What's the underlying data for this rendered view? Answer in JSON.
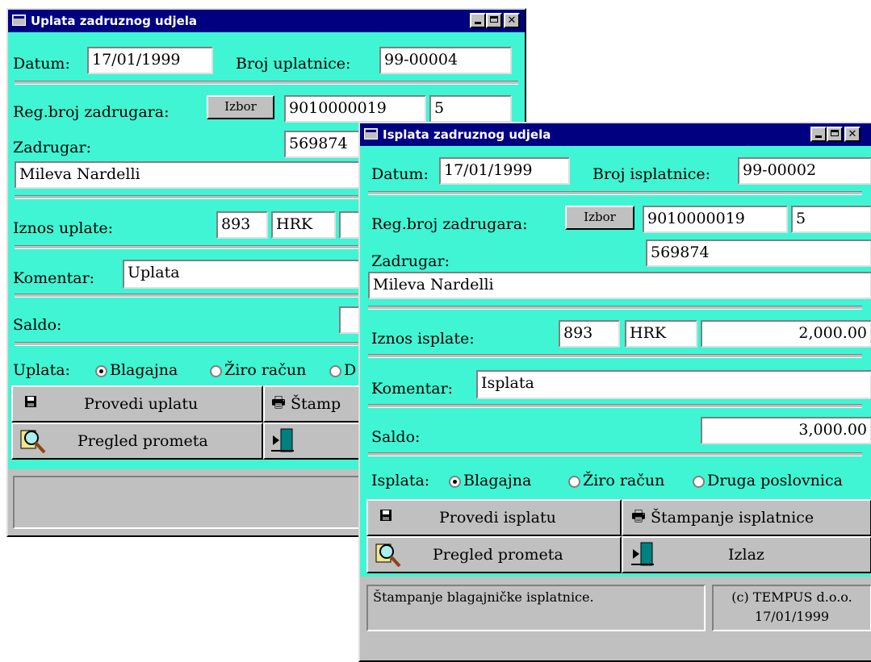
{
  "uplata": {
    "title": "Uplata zadruznog udjela",
    "datum_label": "Datum:",
    "datum_value": "17/01/1999",
    "broj_label": "Broj uplatnice:",
    "broj_value": "99-00004",
    "reg_label": "Reg.broj zadrugara:",
    "izbor": "Izbor",
    "reg_value": "9010000019",
    "reg_extra": "5",
    "zadrugar_label": "Zadrugar:",
    "zadrugar_value": "569874",
    "zadrugar_name": "Mileva Nardelli",
    "iznos_label": "Iznos uplate:",
    "iznos_value": "893",
    "currency": "HRK",
    "komentar_label": "Komentar:",
    "komentar_value": "Uplata",
    "saldo_label": "Saldo:",
    "nacin_label": "Uplata:",
    "opt_blagajna": "Blagajna",
    "opt_ziro": "Žiro račun",
    "opt_druga": "D",
    "btn_provedi": "Provedi uplatu",
    "btn_stampanje": "Štamp",
    "btn_pregled": "Pregled prometa"
  },
  "isplata": {
    "title": "Isplata zadruznog udjela",
    "datum_label": "Datum:",
    "datum_value": "17/01/1999",
    "broj_label": "Broj isplatnice:",
    "broj_value": "99-00002",
    "reg_label": "Reg.broj zadrugara:",
    "izbor": "Izbor",
    "reg_value": "9010000019",
    "reg_extra": "5",
    "zadrugar_label": "Zadrugar:",
    "zadrugar_value": "569874",
    "zadrugar_name": "Mileva Nardelli",
    "iznos_label": "Iznos isplate:",
    "iznos_value": "893",
    "currency": "HRK",
    "iznos_amount": "2,000.00",
    "komentar_label": "Komentar:",
    "komentar_value": "Isplata",
    "saldo_label": "Saldo:",
    "saldo_value": "3,000.00",
    "nacin_label": "Isplata:",
    "opt_blagajna": "Blagajna",
    "opt_ziro": "Žiro račun",
    "opt_druga": "Druga poslovnica",
    "btn_provedi": "Provedi isplatu",
    "btn_stampanje": "Štampanje isplatnice",
    "btn_pregled": "Pregled prometa",
    "btn_izlaz": "Izlaz",
    "status_text": "Štampanje blagajničke isplatnice.",
    "status_copyright": "(c) TEMPUS d.o.o.",
    "status_date": "17/01/1999"
  },
  "colors": {
    "form_bg": "#40f5d4",
    "title_bar": "#000080",
    "face": "#c0c0c0"
  }
}
